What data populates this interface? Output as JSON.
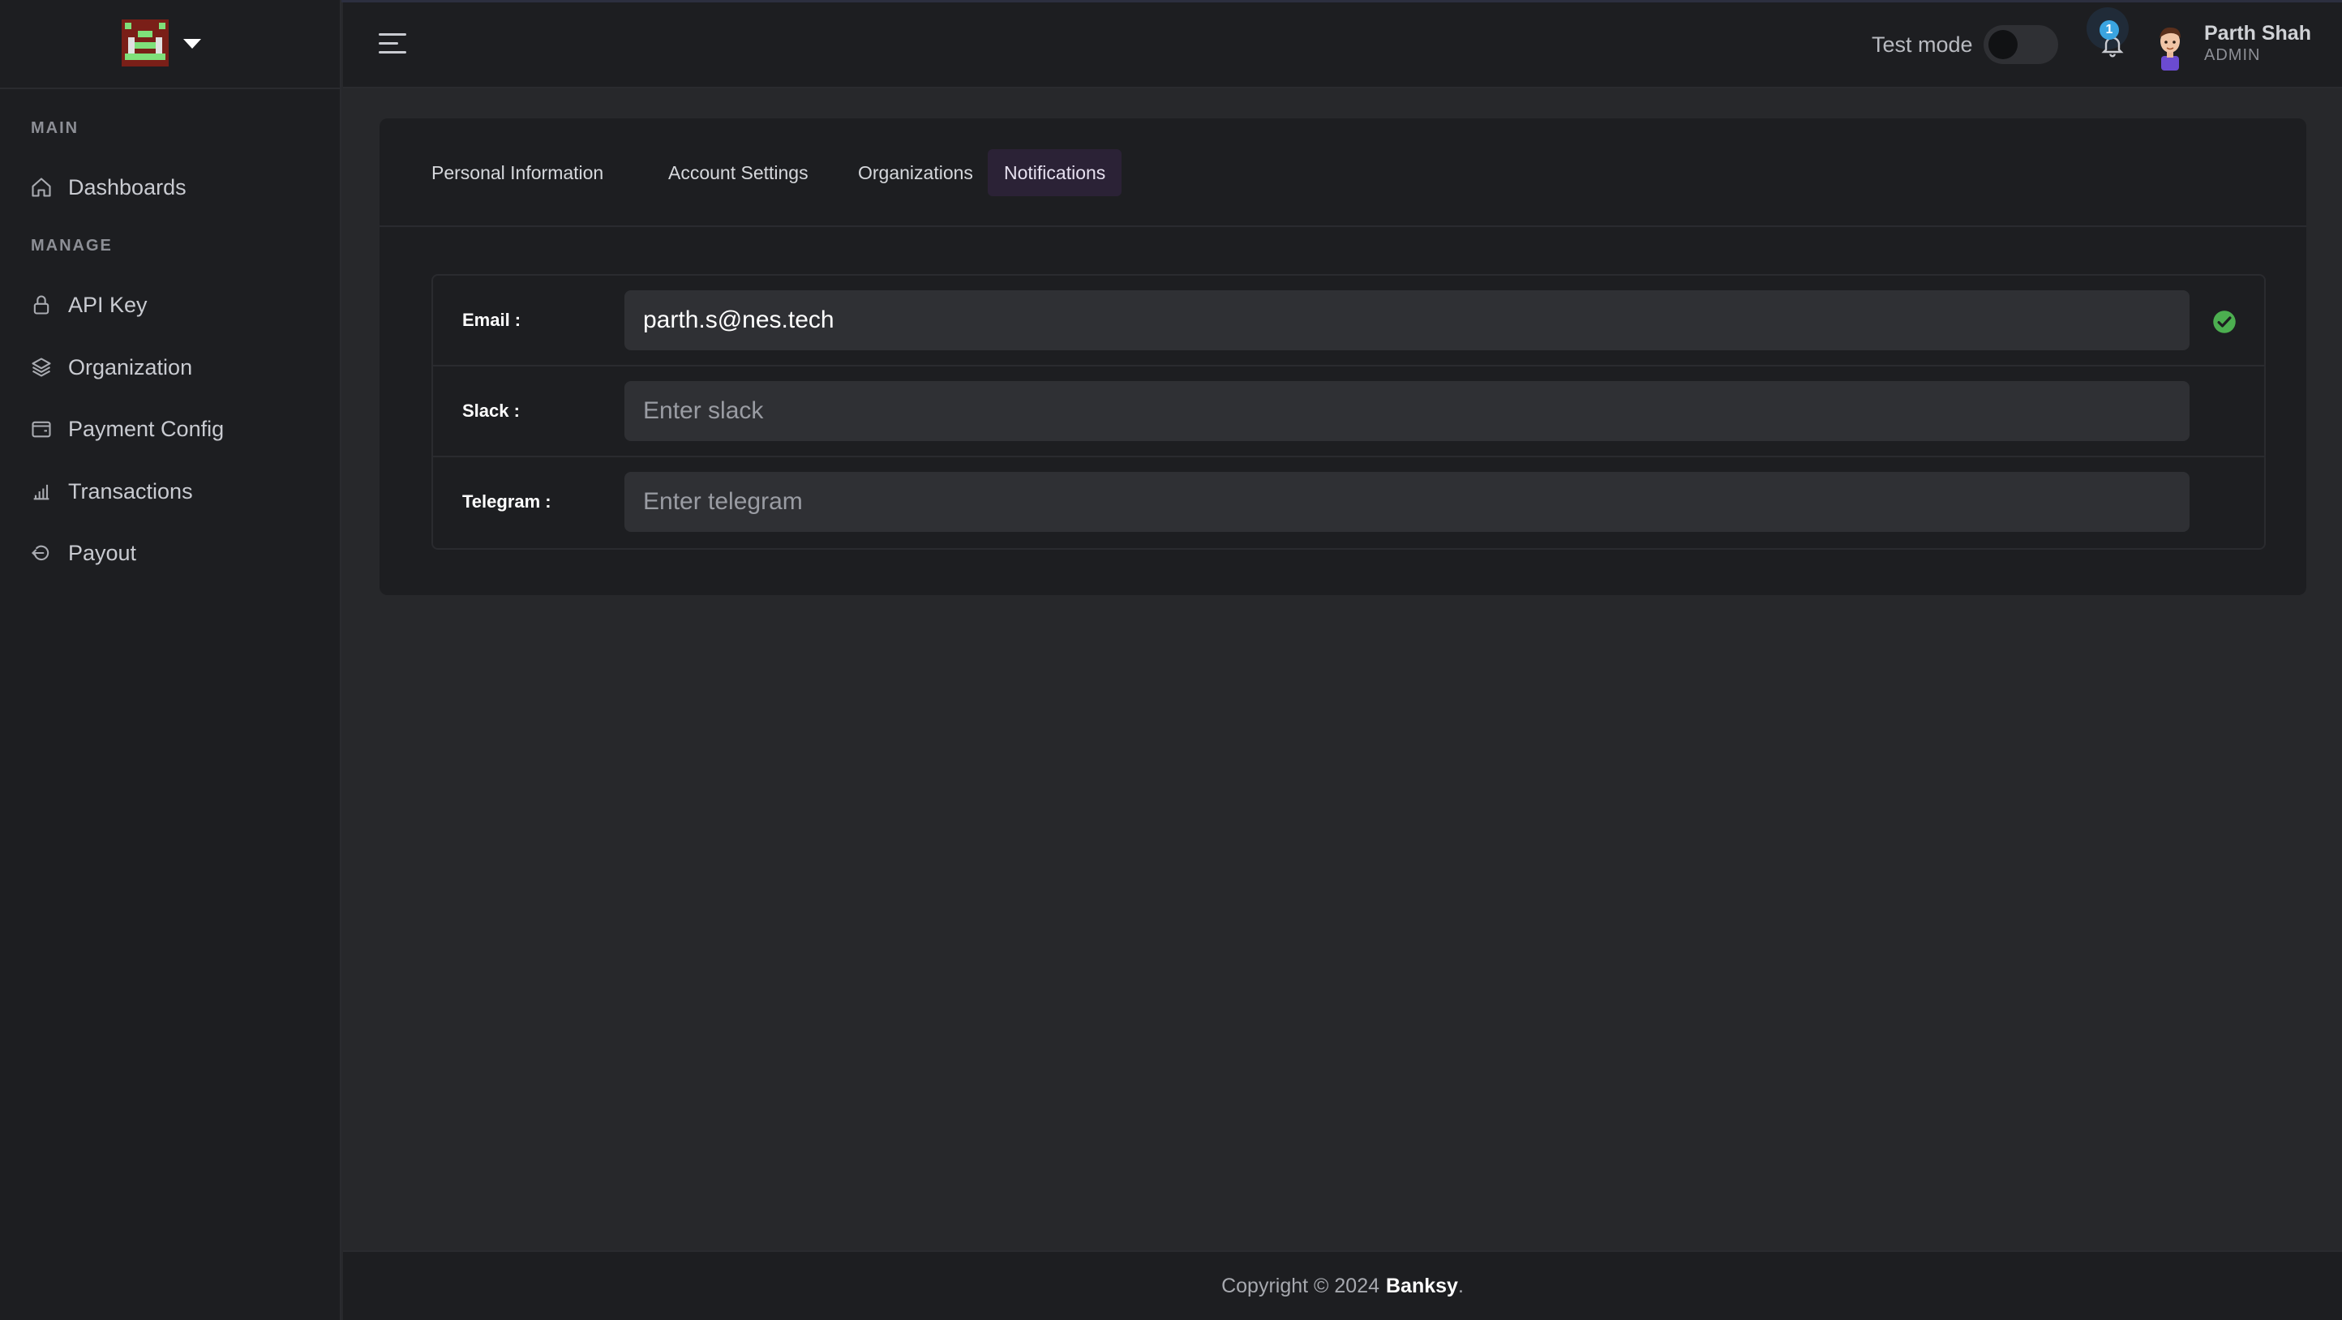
{
  "sidebar": {
    "sections": [
      {
        "label": "MAIN"
      },
      {
        "label": "MANAGE"
      }
    ],
    "items": [
      {
        "label": "Dashboards",
        "icon": "home-icon"
      },
      {
        "label": "API Key",
        "icon": "lock-icon"
      },
      {
        "label": "Organization",
        "icon": "layers-icon"
      },
      {
        "label": "Payment Config",
        "icon": "wallet-icon"
      },
      {
        "label": "Transactions",
        "icon": "bar-chart-icon"
      },
      {
        "label": "Payout",
        "icon": "logout-icon"
      }
    ]
  },
  "header": {
    "test_mode_label": "Test mode",
    "test_mode_on": false,
    "notification_count": "1",
    "user": {
      "name": "Parth Shah",
      "role": "ADMIN"
    }
  },
  "tabs": [
    {
      "label": "Personal Information",
      "active": false
    },
    {
      "label": "Account Settings",
      "active": false
    },
    {
      "label": "Organizations",
      "active": false
    },
    {
      "label": "Notifications",
      "active": true
    }
  ],
  "form": {
    "email": {
      "label": "Email :",
      "value": "parth.s@nes.tech",
      "verified": true
    },
    "slack": {
      "label": "Slack :",
      "value": "",
      "placeholder": "Enter slack"
    },
    "telegram": {
      "label": "Telegram :",
      "value": "",
      "placeholder": "Enter telegram"
    }
  },
  "footer": {
    "prefix": "Copyright © 2024",
    "brand": "Banksy",
    "suffix": "."
  },
  "colors": {
    "accent_check": "#4caf50",
    "badge": "#3aa4e0",
    "active_tab_bg": "#2b2236"
  }
}
